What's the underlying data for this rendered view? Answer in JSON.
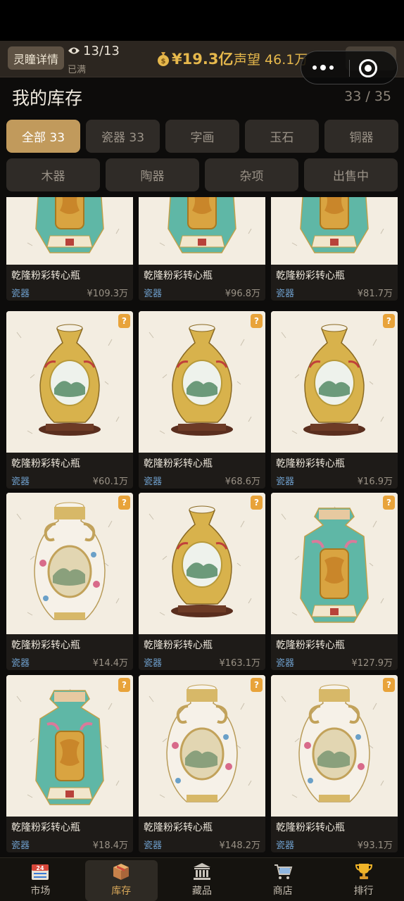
{
  "header": {
    "detail_button": "灵瞳详情",
    "visitor_count": "13/13",
    "visitor_status": "已满",
    "money": "¥19.3亿",
    "reputation": "声望 46.1万"
  },
  "page": {
    "title": "我的库存",
    "count": "33 / 35"
  },
  "tabs_row1": [
    {
      "label": "全部 33",
      "active": true
    },
    {
      "label": "瓷器 33",
      "active": false
    },
    {
      "label": "字画",
      "active": false
    },
    {
      "label": "玉石",
      "active": false
    },
    {
      "label": "铜器",
      "active": false
    }
  ],
  "tabs_row2": [
    {
      "label": "木器"
    },
    {
      "label": "陶器"
    },
    {
      "label": "杂项"
    },
    {
      "label": "出售中"
    }
  ],
  "badge_symbol": "?",
  "items": [
    {
      "name": "乾隆粉彩转心瓶",
      "category": "瓷器",
      "price": "¥109.3万",
      "vase": "octagonal",
      "badge": false
    },
    {
      "name": "乾隆粉彩转心瓶",
      "category": "瓷器",
      "price": "¥96.8万",
      "vase": "octagonal",
      "badge": false
    },
    {
      "name": "乾隆粉彩转心瓶",
      "category": "瓷器",
      "price": "¥81.7万",
      "vase": "octagonal",
      "badge": false
    },
    {
      "name": "乾隆粉彩转心瓶",
      "category": "瓷器",
      "price": "¥60.1万",
      "vase": "gold",
      "badge": true
    },
    {
      "name": "乾隆粉彩转心瓶",
      "category": "瓷器",
      "price": "¥68.6万",
      "vase": "gold",
      "badge": true
    },
    {
      "name": "乾隆粉彩转心瓶",
      "category": "瓷器",
      "price": "¥16.9万",
      "vase": "gold",
      "badge": true
    },
    {
      "name": "乾隆粉彩转心瓶",
      "category": "瓷器",
      "price": "¥14.4万",
      "vase": "handled",
      "badge": true
    },
    {
      "name": "乾隆粉彩转心瓶",
      "category": "瓷器",
      "price": "¥163.1万",
      "vase": "gold",
      "badge": true
    },
    {
      "name": "乾隆粉彩转心瓶",
      "category": "瓷器",
      "price": "¥127.9万",
      "vase": "octagonal",
      "badge": true
    },
    {
      "name": "乾隆粉彩转心瓶",
      "category": "瓷器",
      "price": "¥18.4万",
      "vase": "octagonal",
      "badge": true
    },
    {
      "name": "乾隆粉彩转心瓶",
      "category": "瓷器",
      "price": "¥148.2万",
      "vase": "handled",
      "badge": true
    },
    {
      "name": "乾隆粉彩转心瓶",
      "category": "瓷器",
      "price": "¥93.1万",
      "vase": "handled",
      "badge": true
    }
  ],
  "nav": [
    {
      "label": "市场",
      "icon": "calendar-icon",
      "badge": "24"
    },
    {
      "label": "库存",
      "icon": "box-icon",
      "active": true
    },
    {
      "label": "藏品",
      "icon": "museum-icon"
    },
    {
      "label": "商店",
      "icon": "cart-icon"
    },
    {
      "label": "排行",
      "icon": "trophy-icon"
    }
  ],
  "colors": {
    "accent_gold": "#c19a5c",
    "money_gold": "#e6b84c",
    "category_blue": "#6f9fcc",
    "badge_orange": "#e8a33a"
  }
}
